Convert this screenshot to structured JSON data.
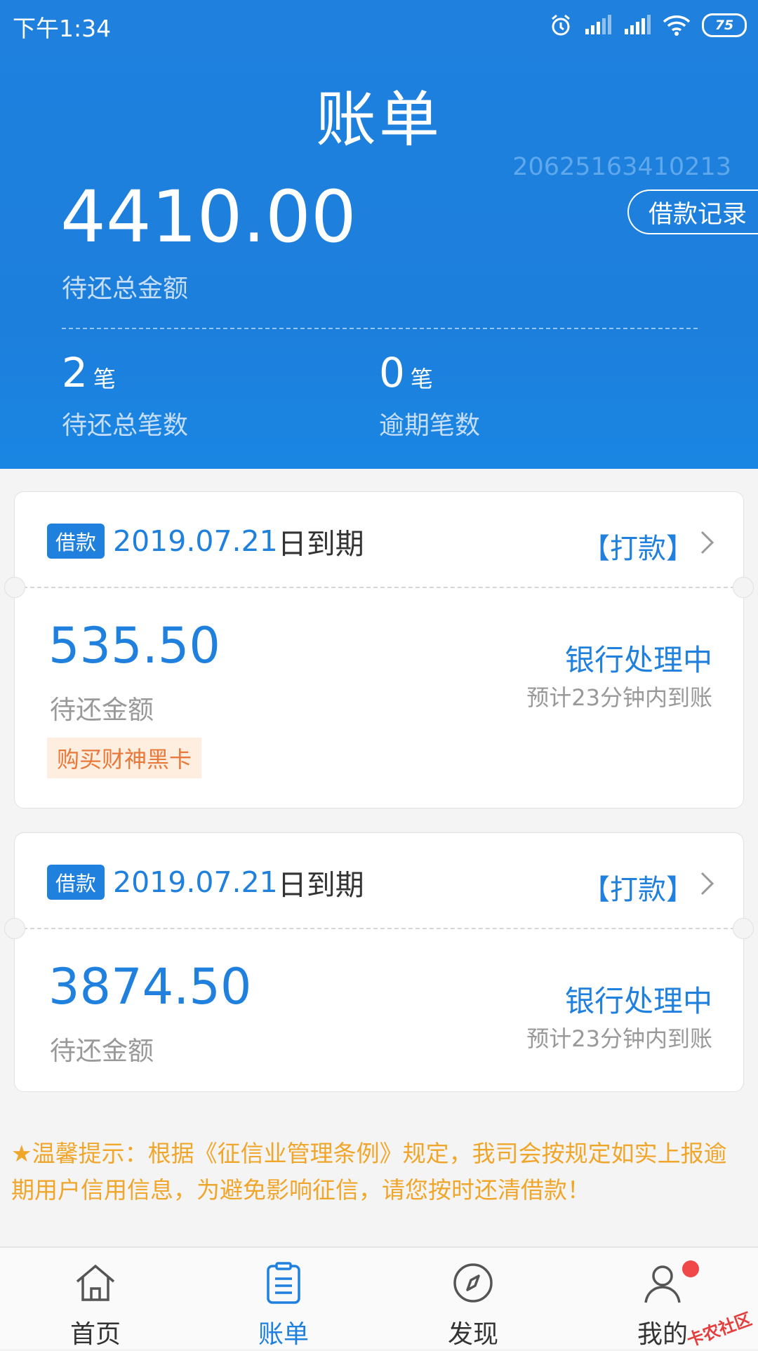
{
  "status_bar": {
    "time": "下午1:34",
    "battery": "75"
  },
  "header": {
    "title": "账单",
    "order_no": "20625163410213",
    "record_button": "借款记录",
    "total_amount": "4410.00",
    "total_label": "待还总金额",
    "stats": [
      {
        "num": "2",
        "unit": "笔",
        "label": "待还总笔数"
      },
      {
        "num": "0",
        "unit": "笔",
        "label": "逾期笔数"
      }
    ]
  },
  "bills": [
    {
      "tag": "借款",
      "due_date": "2019.07.21",
      "due_suffix": "日到期",
      "action": "【打款】",
      "amount": "535.50",
      "amount_label": "待还金额",
      "status": "银行处理中",
      "status_sub": "预计23分钟内到账",
      "promo": "购买财神黑卡"
    },
    {
      "tag": "借款",
      "due_date": "2019.07.21",
      "due_suffix": "日到期",
      "action": "【打款】",
      "amount": "3874.50",
      "amount_label": "待还金额",
      "status": "银行处理中",
      "status_sub": "预计23分钟内到账"
    }
  ],
  "notice": "★温馨提示：根据《征信业管理条例》规定，我司会按规定如实上报逾期用户信用信息，为避免影响征信，请您按时还清借款！",
  "tabbar": {
    "items": [
      {
        "label": "首页",
        "icon": "home-icon"
      },
      {
        "label": "账单",
        "icon": "bill-icon",
        "active": true
      },
      {
        "label": "发现",
        "icon": "compass-icon"
      },
      {
        "label": "我的",
        "icon": "user-icon"
      }
    ]
  },
  "watermark": "卡农社区",
  "colors": {
    "primary": "#1f80de",
    "warning": "#f0a62b",
    "promo": "#e8793a",
    "badge": "#f04848"
  }
}
